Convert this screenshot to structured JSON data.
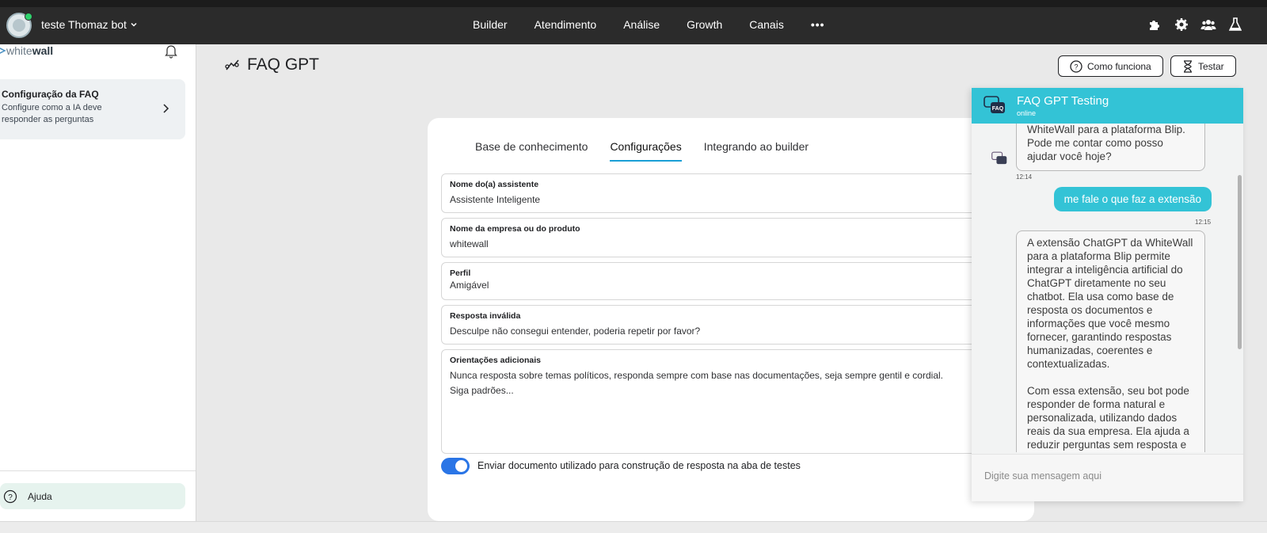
{
  "header": {
    "bot_name": "teste Thomaz bot",
    "nav": [
      "Builder",
      "Atendimento",
      "Análise",
      "Growth",
      "Canais"
    ],
    "more": "•••",
    "icons": [
      "puzzle-icon",
      "gear-icon",
      "team-icon",
      "flask-icon"
    ]
  },
  "sidebar": {
    "brand_light": "white",
    "brand_bold": "wall",
    "faq_title": "Configuração da FAQ",
    "faq_desc": "Configure como a IA deve responder as perguntas",
    "help": "Ajuda"
  },
  "main": {
    "title": "FAQ GPT",
    "how_button": "Como funciona",
    "test_button": "Testar",
    "tabs": [
      "Base de conhecimento",
      "Configurações",
      "Integrando ao builder"
    ],
    "active_tab": "Configurações",
    "fields": [
      {
        "label": "Nome do(a) assistente",
        "value": "Assistente Inteligente"
      },
      {
        "label": "Nome da empresa ou do produto",
        "value": "whitewall"
      },
      {
        "label": "Perfil",
        "value": "Amigável"
      },
      {
        "label": "Resposta inválida",
        "value": "Desculpe não consegui entender, poderia repetir por favor?"
      },
      {
        "label": "Orientações adicionais",
        "value_line1": "Nunca resposta sobre temas políticos, responda sempre com base nas documentações, seja sempre gentil e cordial.",
        "value_line2": "Siga padrões..."
      }
    ],
    "toggle_label": "Enviar documento utilizado para construção de resposta na aba de testes",
    "toggle_on": true
  },
  "chat": {
    "title": "FAQ GPT Testing",
    "status": "online",
    "logo_text": "FAQ",
    "messages": [
      {
        "from": "bot",
        "text": "WhiteWall para a plataforma Blip. Pode me contar como posso ajudar você hoje?",
        "time": "12:14"
      },
      {
        "from": "user",
        "text": "me fale o que faz a extensão",
        "time": "12:15"
      },
      {
        "from": "bot",
        "text_p1": "A extensão ChatGPT da WhiteWall para a plataforma Blip permite integrar a inteligência artificial do ChatGPT diretamente no seu chatbot. Ela usa como base de resposta os documentos e informações que você mesmo fornecer, garantindo respostas humanizadas, coerentes e contextualizadas.",
        "text_p2": "Com essa extensão, seu bot pode responder de forma natural e personalizada, utilizando dados reais da sua empresa. Ela ajuda a reduzir perguntas sem resposta e"
      }
    ],
    "input_placeholder": "Digite sua mensagem aqui",
    "header_color": "#33c3d6"
  }
}
